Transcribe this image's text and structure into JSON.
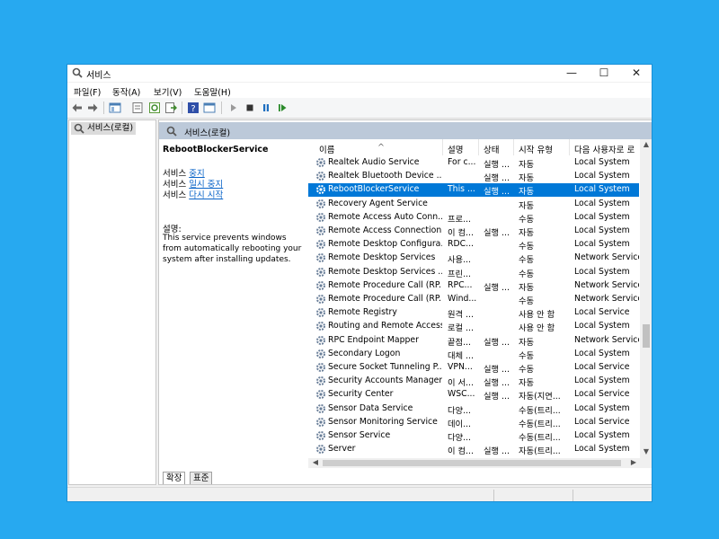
{
  "window": {
    "title": "서비스",
    "controls": {
      "minimize": "—",
      "maximize": "☐",
      "close": "✕"
    }
  },
  "menu": {
    "items": [
      "파일(F)",
      "동작(A)",
      "보기(V)",
      "도움말(H)"
    ]
  },
  "tree": {
    "root_label": "서비스(로컬)"
  },
  "content_header": {
    "title": "서비스(로컬)"
  },
  "detail": {
    "service_name": "RebootBlockerService",
    "action_prefix": "서비스",
    "actions": [
      "중지",
      "일시 중지",
      "다시 시작"
    ],
    "description_label": "설명:",
    "description": "This service prevents windows from automatically rebooting your system after installing updates."
  },
  "columns": [
    "이름",
    "설명",
    "상태",
    "시작 유형",
    "다음 사용자로 로"
  ],
  "services": [
    {
      "name": "Realtek Audio Service",
      "desc": "For c...",
      "status": "실행 ...",
      "startup": "자동",
      "logon": "Local System",
      "selected": false
    },
    {
      "name": "Realtek Bluetooth Device ...",
      "desc": "",
      "status": "실행 ...",
      "startup": "자동",
      "logon": "Local System",
      "selected": false
    },
    {
      "name": "RebootBlockerService",
      "desc": "This ...",
      "status": "실행 ...",
      "startup": "자동",
      "logon": "Local System",
      "selected": true
    },
    {
      "name": "Recovery Agent Service",
      "desc": "",
      "status": "",
      "startup": "자동",
      "logon": "Local System",
      "selected": false
    },
    {
      "name": "Remote Access Auto Conn...",
      "desc": "프로...",
      "status": "",
      "startup": "수동",
      "logon": "Local System",
      "selected": false
    },
    {
      "name": "Remote Access Connection...",
      "desc": "이 컴...",
      "status": "실행 ...",
      "startup": "자동",
      "logon": "Local System",
      "selected": false
    },
    {
      "name": "Remote Desktop Configura...",
      "desc": "RDC...",
      "status": "",
      "startup": "수동",
      "logon": "Local System",
      "selected": false
    },
    {
      "name": "Remote Desktop Services",
      "desc": "사용...",
      "status": "",
      "startup": "수동",
      "logon": "Network Service",
      "selected": false
    },
    {
      "name": "Remote Desktop Services ...",
      "desc": "프린...",
      "status": "",
      "startup": "수동",
      "logon": "Local System",
      "selected": false
    },
    {
      "name": "Remote Procedure Call (RP...",
      "desc": "RPC...",
      "status": "실행 ...",
      "startup": "자동",
      "logon": "Network Service",
      "selected": false
    },
    {
      "name": "Remote Procedure Call (RP...",
      "desc": "Wind...",
      "status": "",
      "startup": "수동",
      "logon": "Network Service",
      "selected": false
    },
    {
      "name": "Remote Registry",
      "desc": "원격 ...",
      "status": "",
      "startup": "사용 안 함",
      "logon": "Local Service",
      "selected": false
    },
    {
      "name": "Routing and Remote Access",
      "desc": "로컬 ...",
      "status": "",
      "startup": "사용 안 함",
      "logon": "Local System",
      "selected": false
    },
    {
      "name": "RPC Endpoint Mapper",
      "desc": "끝점...",
      "status": "실행 ...",
      "startup": "자동",
      "logon": "Network Service",
      "selected": false
    },
    {
      "name": "Secondary Logon",
      "desc": "대체 ...",
      "status": "",
      "startup": "수동",
      "logon": "Local System",
      "selected": false
    },
    {
      "name": "Secure Socket Tunneling P...",
      "desc": "VPN...",
      "status": "실행 ...",
      "startup": "수동",
      "logon": "Local Service",
      "selected": false
    },
    {
      "name": "Security Accounts Manager",
      "desc": "이 서...",
      "status": "실행 ...",
      "startup": "자동",
      "logon": "Local System",
      "selected": false
    },
    {
      "name": "Security Center",
      "desc": "WSC...",
      "status": "실행 ...",
      "startup": "자동(지연...",
      "logon": "Local Service",
      "selected": false
    },
    {
      "name": "Sensor Data Service",
      "desc": "다양...",
      "status": "",
      "startup": "수동(트리...",
      "logon": "Local System",
      "selected": false
    },
    {
      "name": "Sensor Monitoring Service",
      "desc": "데이...",
      "status": "",
      "startup": "수동(트리...",
      "logon": "Local Service",
      "selected": false
    },
    {
      "name": "Sensor Service",
      "desc": "다양...",
      "status": "",
      "startup": "수동(트리...",
      "logon": "Local System",
      "selected": false
    },
    {
      "name": "Server",
      "desc": "이 컴...",
      "status": "실행 ...",
      "startup": "자동(트리...",
      "logon": "Local System",
      "selected": false
    }
  ],
  "tabs": [
    "확장",
    "표준"
  ],
  "colors": {
    "selection": "#0078d7",
    "desktop": "#27a9f0",
    "link": "#0a64c8"
  }
}
